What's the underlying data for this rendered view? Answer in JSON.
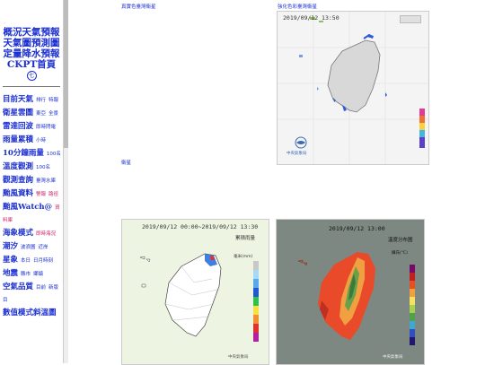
{
  "sidebar": {
    "headings": [
      "概況天氣預報",
      "天氣圖預測圖",
      "定量降水預報",
      "CKPT首頁"
    ],
    "items": [
      {
        "label": "目前天氣",
        "links": [
          "排行",
          "特報"
        ]
      },
      {
        "label": "衛星雲圖",
        "links": [
          "東亞",
          "全景"
        ]
      },
      {
        "label": "雷達回波",
        "links": [
          "即時閃電"
        ]
      },
      {
        "label": "雨量累積",
        "links": [
          "小時"
        ]
      },
      {
        "label": "10分鐘雨量",
        "links": [
          "100名"
        ]
      },
      {
        "label": "溫度觀測",
        "links": [
          "100名"
        ]
      },
      {
        "label": "觀測查詢",
        "links": [
          "臺灣水庫"
        ]
      },
      {
        "label": "颱風資料",
        "links": [
          "警報",
          "路徑"
        ]
      },
      {
        "label": "颱風Watch@",
        "links": [
          "資料庫"
        ]
      },
      {
        "label": "海象模式",
        "links": [
          "即時海況"
        ]
      },
      {
        "label": "潮汐",
        "links": [
          "波浪圖",
          "近岸"
        ]
      },
      {
        "label": "星象",
        "links": [
          "本日",
          "日月時刻"
        ]
      },
      {
        "label": "地震",
        "links": [
          "縣市",
          "鄉鎮"
        ]
      },
      {
        "label": "空氣品質",
        "links": [
          "目前",
          "新版目"
        ]
      },
      {
        "label": "數值模式斜溫圖",
        "links": []
      }
    ]
  },
  "captions": {
    "true_color": "真實色臺灣衛星",
    "enhanced": "強化色彩臺灣衛星",
    "satellite": "衛星"
  },
  "satellite_timestamp": "2019/09/12 13:50",
  "rain_timestamp": "2019/09/12 00:00~2019/09/12 13:30",
  "temp_timestamp": "2019/09/12 13:00",
  "rain_title": "累積雨量",
  "rain_unit": "毫米(mm)",
  "temp_title": "溫度分布圖",
  "temp_unit": "攝氏(°C)",
  "cwb_label": "中央氣象局",
  "colors": {
    "link": "#1c2fd0",
    "accent": "#cc2266"
  }
}
